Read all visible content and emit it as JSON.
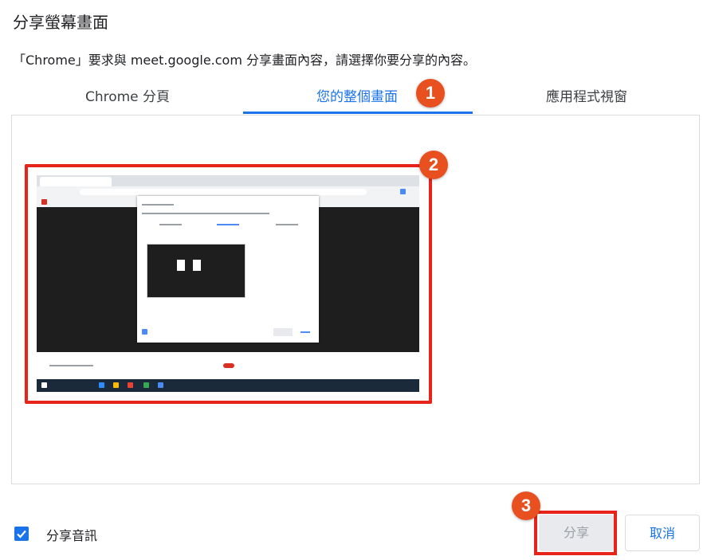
{
  "dialog": {
    "title": "分享螢幕畫面",
    "description": "「Chrome」要求與 meet.google.com 分享畫面內容，請選擇你要分享的內容。"
  },
  "tabs": [
    {
      "label": "Chrome 分頁",
      "active": false
    },
    {
      "label": "您的整個畫面",
      "active": true
    },
    {
      "label": "應用程式視窗",
      "active": false
    }
  ],
  "badges": {
    "one": "1",
    "two": "2",
    "three": "3"
  },
  "audio": {
    "label": "分享音訊",
    "checked": true
  },
  "buttons": {
    "share": "分享",
    "cancel": "取消"
  },
  "colors": {
    "accent": "#1a73e8",
    "highlight": "#e8231a",
    "badge": "#e8501f"
  }
}
